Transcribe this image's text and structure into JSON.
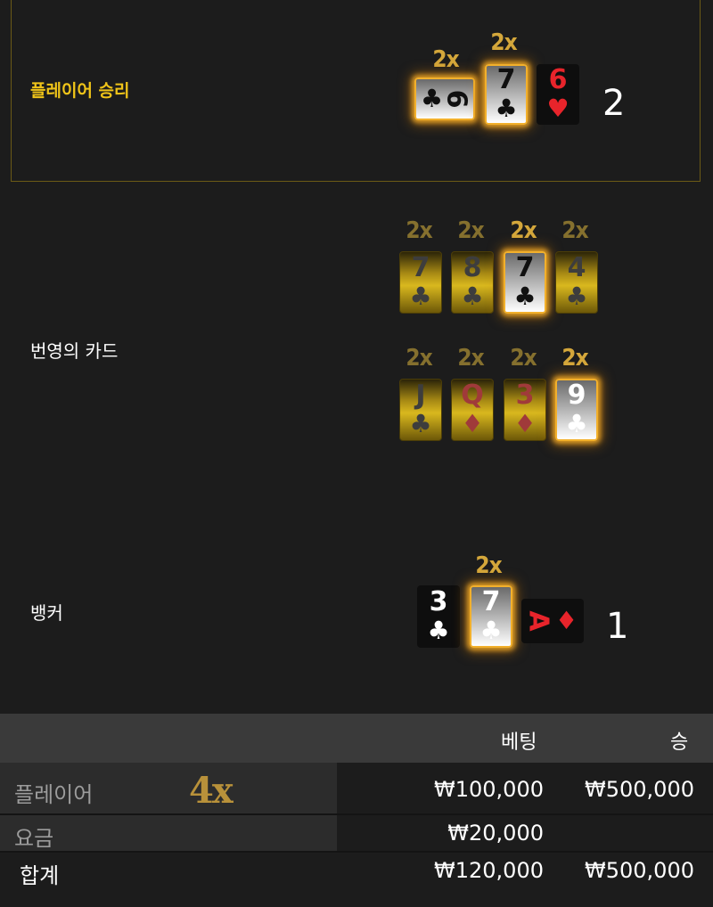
{
  "player": {
    "label": "플레이어 승리",
    "score": "2",
    "cards": [
      {
        "rank": "9",
        "suit": "♣",
        "multiplier": "2x"
      },
      {
        "rank": "7",
        "suit": "♣",
        "multiplier": "2x"
      },
      {
        "rank": "6",
        "suit": "♥"
      }
    ]
  },
  "lightning": {
    "label": "번영의 카드",
    "row1": [
      {
        "rank": "7",
        "suit": "♣",
        "multiplier": "2x"
      },
      {
        "rank": "8",
        "suit": "♣",
        "multiplier": "2x"
      },
      {
        "rank": "7",
        "suit": "♣",
        "multiplier": "2x"
      },
      {
        "rank": "4",
        "suit": "♣",
        "multiplier": "2x"
      }
    ],
    "row2": [
      {
        "rank": "J",
        "suit": "♣",
        "multiplier": "2x"
      },
      {
        "rank": "Q",
        "suit": "♦",
        "multiplier": "2x"
      },
      {
        "rank": "3",
        "suit": "♦",
        "multiplier": "2x"
      },
      {
        "rank": "9",
        "suit": "♣",
        "multiplier": "2x"
      }
    ]
  },
  "banker": {
    "label": "뱅커",
    "score": "1",
    "cards": [
      {
        "rank": "3",
        "suit": "♣"
      },
      {
        "rank": "7",
        "suit": "♣",
        "multiplier": "2x"
      },
      {
        "rank": "A",
        "suit": "♦"
      }
    ]
  },
  "summary": {
    "headers": {
      "bet": "베팅",
      "win": "승"
    },
    "rows": [
      {
        "label": "플레이어",
        "multiplier": "4x",
        "bet": "₩100,000",
        "win": "₩500,000"
      },
      {
        "label": "요금",
        "bet": "₩20,000",
        "win": ""
      },
      {
        "label": "합계",
        "bet": "₩120,000",
        "win": "₩500,000"
      }
    ]
  },
  "colors": {
    "accent_gold": "#f0c419",
    "red_suit": "#e8242b",
    "header_bg": "#3a3a3a"
  }
}
